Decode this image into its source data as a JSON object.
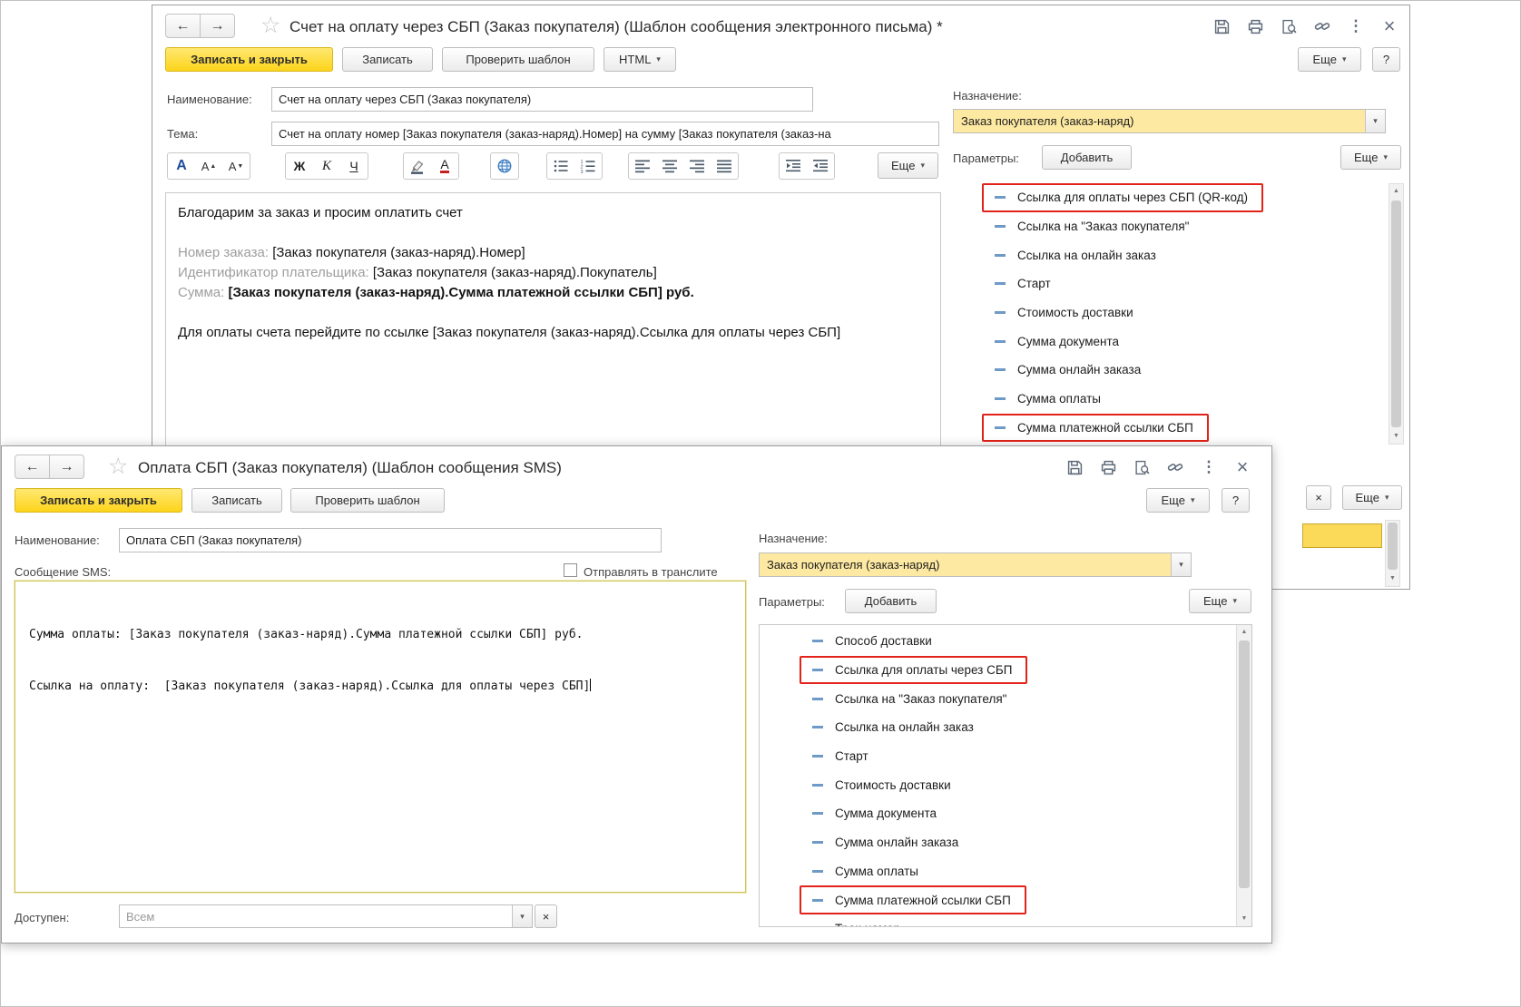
{
  "email": {
    "title": "Счет на оплату через СБП (Заказ покупателя) (Шаблон сообщения электронного письма) *",
    "buttons": {
      "save_close": "Записать и закрыть",
      "save": "Записать",
      "check": "Проверить шаблон",
      "html": "HTML",
      "more": "Еще",
      "help": "?"
    },
    "name_label": "Наименование:",
    "name_value": "Счет на оплату через СБП (Заказ покупателя)",
    "subject_label": "Тема:",
    "subject_value": "Счет на оплату номер [Заказ покупателя (заказ-наряд).Номер] на сумму [Заказ покупателя (заказ-на",
    "format": {
      "font": "А",
      "bold": "Ж",
      "italic": "К",
      "underline": "Ч",
      "color": "А",
      "more": "Еще"
    },
    "body": {
      "greeting": "Благодарим за заказ и просим оплатить счет",
      "order_label": "Номер заказа:",
      "order_value": "[Заказ покупателя (заказ-наряд).Номер]",
      "payer_label": "Идентификатор плательщика:",
      "payer_value": "[Заказ покупателя (заказ-наряд).Покупатель]",
      "amount_label": "Сумма:",
      "amount_value": "[Заказ покупателя (заказ-наряд).Сумма платежной ссылки СБП] руб.",
      "pay_text": "Для оплаты счета перейдите по ссылке [Заказ покупателя (заказ-наряд).Ссылка для оплаты через СБП]"
    },
    "right": {
      "purpose_label": "Назначение:",
      "purpose_value": "Заказ покупателя (заказ-наряд)",
      "params_label": "Параметры:",
      "add": "Добавить",
      "more": "Еще",
      "params": [
        {
          "label": "Ссылка для оплаты через СБП (QR-код)"
        },
        {
          "label": "Ссылка на \"Заказ покупателя\""
        },
        {
          "label": "Ссылка на онлайн заказ"
        },
        {
          "label": "Старт"
        },
        {
          "label": "Стоимость доставки"
        },
        {
          "label": "Сумма документа"
        },
        {
          "label": "Сумма онлайн заказа"
        },
        {
          "label": "Сумма оплаты"
        },
        {
          "label": "Сумма платежной ссылки СБП"
        }
      ]
    },
    "partial": {
      "close": "×",
      "more": "Еще"
    }
  },
  "sms": {
    "title": "Оплата СБП (Заказ покупателя) (Шаблон сообщения SMS)",
    "buttons": {
      "save_close": "Записать и закрыть",
      "save": "Записать",
      "check": "Проверить шаблон",
      "more": "Еще",
      "help": "?"
    },
    "name_label": "Наименование:",
    "name_value": "Оплата СБП (Заказ покупателя)",
    "message_label": "Сообщение SMS:",
    "translit_label": "Отправлять в транслите",
    "message_line1": "Сумма оплаты: [Заказ покупателя (заказ-наряд).Сумма платежной ссылки СБП] руб.",
    "message_line2": "Ссылка на оплату:  [Заказ покупателя (заказ-наряд).Ссылка для оплаты через СБП]",
    "available_label": "Доступен:",
    "available_placeholder": "Всем",
    "clear": "×",
    "right": {
      "purpose_label": "Назначение:",
      "purpose_value": "Заказ покупателя (заказ-наряд)",
      "params_label": "Параметры:",
      "add": "Добавить",
      "more": "Еще",
      "params": [
        {
          "label": "Способ доставки"
        },
        {
          "label": "Ссылка для оплаты через СБП"
        },
        {
          "label": "Ссылка на \"Заказ покупателя\""
        },
        {
          "label": "Ссылка на онлайн заказ"
        },
        {
          "label": "Старт"
        },
        {
          "label": "Стоимость доставки"
        },
        {
          "label": "Сумма документа"
        },
        {
          "label": "Сумма онлайн заказа"
        },
        {
          "label": "Сумма оплаты"
        },
        {
          "label": "Сумма платежной ссылки СБП"
        },
        {
          "label": "Трек-номер"
        }
      ]
    }
  },
  "colors": {
    "primary_yellow": "#fdd41b",
    "field_yellow": "#fde9a2",
    "highlight_red": "#e2231a",
    "param_dash": "#6f9ac8"
  }
}
